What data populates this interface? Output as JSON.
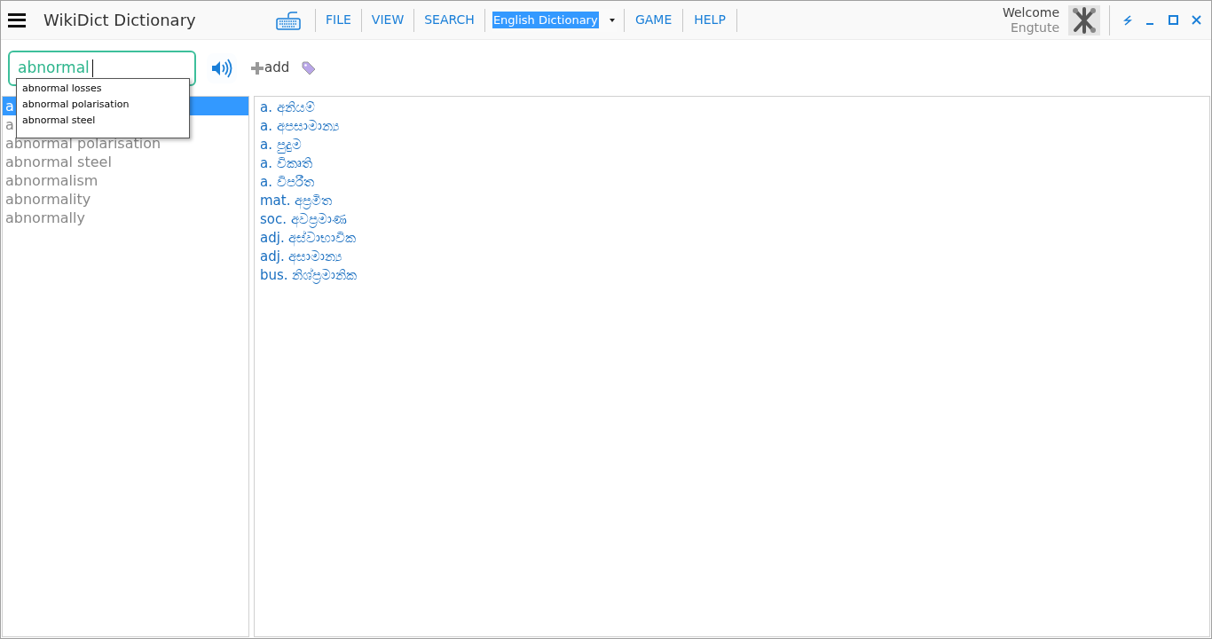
{
  "app_title": "WikiDict Dictionary",
  "menu": [
    "FILE",
    "VIEW",
    "SEARCH"
  ],
  "dictionary_select": {
    "value": "English Dictionary"
  },
  "menu_right": [
    "GAME",
    "HELP"
  ],
  "user": {
    "greeting": "Welcome",
    "name": "Engtute"
  },
  "search": {
    "value": "abnormal"
  },
  "add_label": "add",
  "suggestions": [
    "abnormal losses",
    "abnormal polarisation",
    "abnormal steel"
  ],
  "words": [
    {
      "text": "a",
      "selected": true
    },
    {
      "text": "a",
      "selected": false
    },
    {
      "text": "abnormal polarisation",
      "selected": false
    },
    {
      "text": "abnormal steel",
      "selected": false
    },
    {
      "text": "abnormalism",
      "selected": false
    },
    {
      "text": "abnormality",
      "selected": false
    },
    {
      "text": "abnormally",
      "selected": false
    }
  ],
  "definitions": [
    {
      "pos": "a.",
      "meaning": "අනියම්"
    },
    {
      "pos": "a.",
      "meaning": "අපසාමාන්‍ය"
    },
    {
      "pos": "a.",
      "meaning": "පුදුම"
    },
    {
      "pos": "a.",
      "meaning": "විකෘති"
    },
    {
      "pos": "a.",
      "meaning": "විපරීත"
    },
    {
      "pos": "mat.",
      "meaning": "අප්‍රමිත"
    },
    {
      "pos": "soc.",
      "meaning": "අවප්‍රමාණ"
    },
    {
      "pos": "adj.",
      "meaning": "අස්වාභාවික"
    },
    {
      "pos": "adj.",
      "meaning": "අසාමාන්‍ය"
    },
    {
      "pos": "bus.",
      "meaning": "නිශ්ප්‍රමානික"
    }
  ]
}
